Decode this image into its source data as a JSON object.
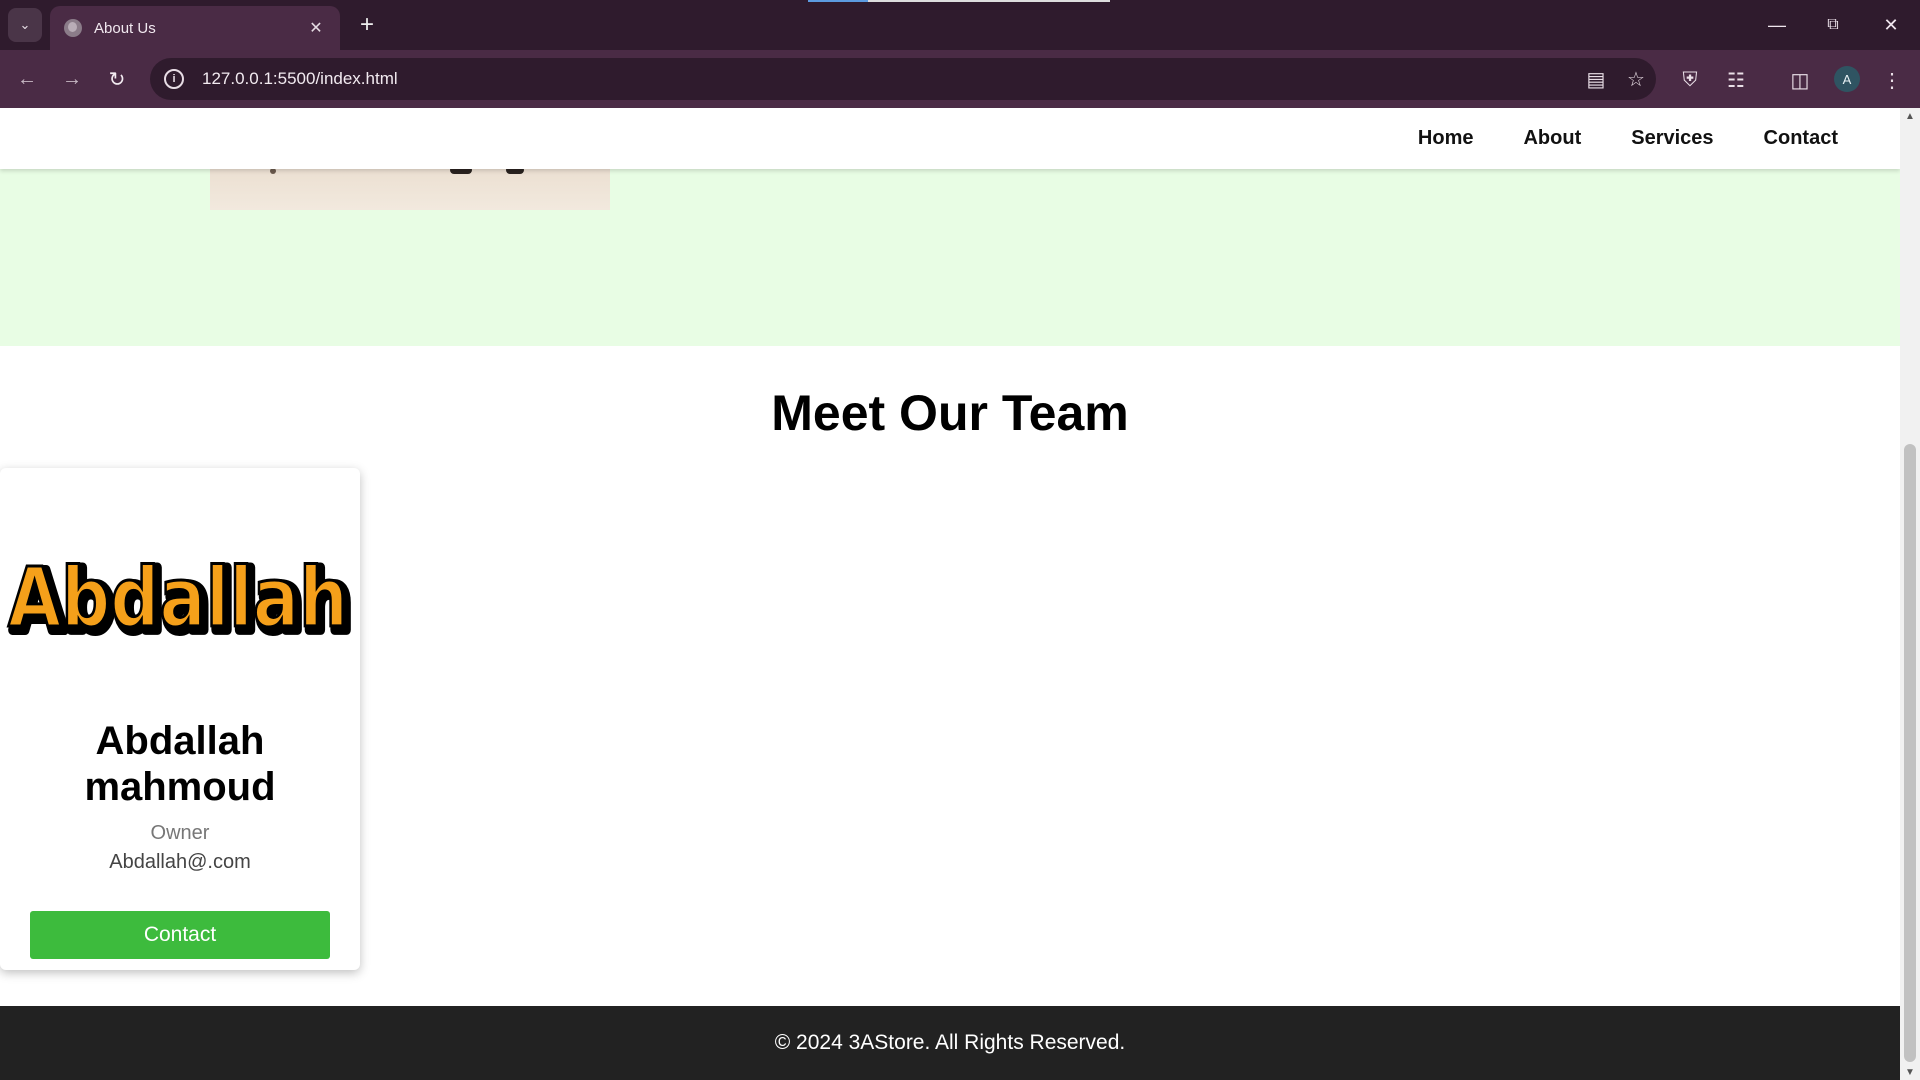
{
  "browser": {
    "tab_title": "About Us",
    "url": "127.0.0.1:5500/index.html",
    "profile_initial": "A",
    "icons": [
      "tab-search-icon",
      "globe-icon",
      "close-icon",
      "plus-icon",
      "minimize-icon",
      "restore-icon",
      "window-close-icon",
      "back-icon",
      "forward-icon",
      "reload-icon",
      "info-icon",
      "translate-icon",
      "star-icon",
      "shield-icon",
      "extensions-icon",
      "sidebar-icon",
      "menu-icon"
    ]
  },
  "nav": {
    "items": [
      "Home",
      "About",
      "Services",
      "Contact"
    ]
  },
  "team": {
    "heading": "Meet Our Team",
    "member": {
      "logo_text": "Abdallah",
      "name": "Abdallah mahmoud",
      "role": "Owner",
      "email": "Abdallah@.com",
      "button": "Contact"
    }
  },
  "footer": {
    "text": "© 2024 3AStore. All Rights Reserved."
  },
  "colors": {
    "hero_bg": "#e8fde4",
    "button": "#3dbb3d",
    "footer_bg": "#222222",
    "logo_orange": "#f5a01a"
  }
}
